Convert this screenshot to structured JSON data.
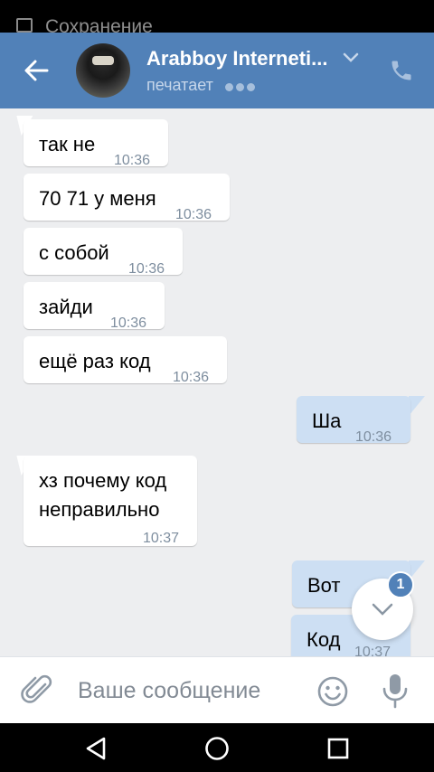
{
  "status_bar": {
    "notification_text": "Сохранение"
  },
  "header": {
    "contact_name": "Arabboy Interneti...",
    "status_text": "печатает"
  },
  "messages": [
    {
      "direction": "in",
      "text": "так не",
      "time": "10:36"
    },
    {
      "direction": "in",
      "text": "70 71 у меня",
      "time": "10:36"
    },
    {
      "direction": "in",
      "text": "с собой",
      "time": "10:36"
    },
    {
      "direction": "in",
      "text": "зайди",
      "time": "10:36"
    },
    {
      "direction": "in",
      "text": "ещё раз код",
      "time": "10:36"
    },
    {
      "direction": "out",
      "text": "Ша",
      "time": "10:36"
    },
    {
      "direction": "in",
      "text_line1": "хз почему код",
      "text_line2": "неправильно",
      "time": "10:37"
    },
    {
      "direction": "out",
      "text": "Вот",
      "time": ""
    },
    {
      "direction": "out",
      "text": "Код",
      "time": "10:37"
    }
  ],
  "scroll_down": {
    "unread_count": "1"
  },
  "composer": {
    "placeholder": "Ваше сообщение"
  },
  "colors": {
    "header": "#5181b8",
    "chat_background": "#edeef0",
    "incoming_bubble": "#ffffff",
    "outgoing_bubble": "#cddff3",
    "badge": "#5181b8"
  },
  "icons": {
    "back": "arrow-left-icon",
    "name_dropdown": "chevron-down-icon",
    "call": "phone-icon",
    "scroll_down": "chevron-down-icon",
    "attach": "paperclip-icon",
    "emoji": "smiley-icon",
    "voice": "microphone-icon",
    "nav_back": "triangle-back-icon",
    "nav_home": "circle-home-icon",
    "nav_recents": "square-recents-icon"
  }
}
